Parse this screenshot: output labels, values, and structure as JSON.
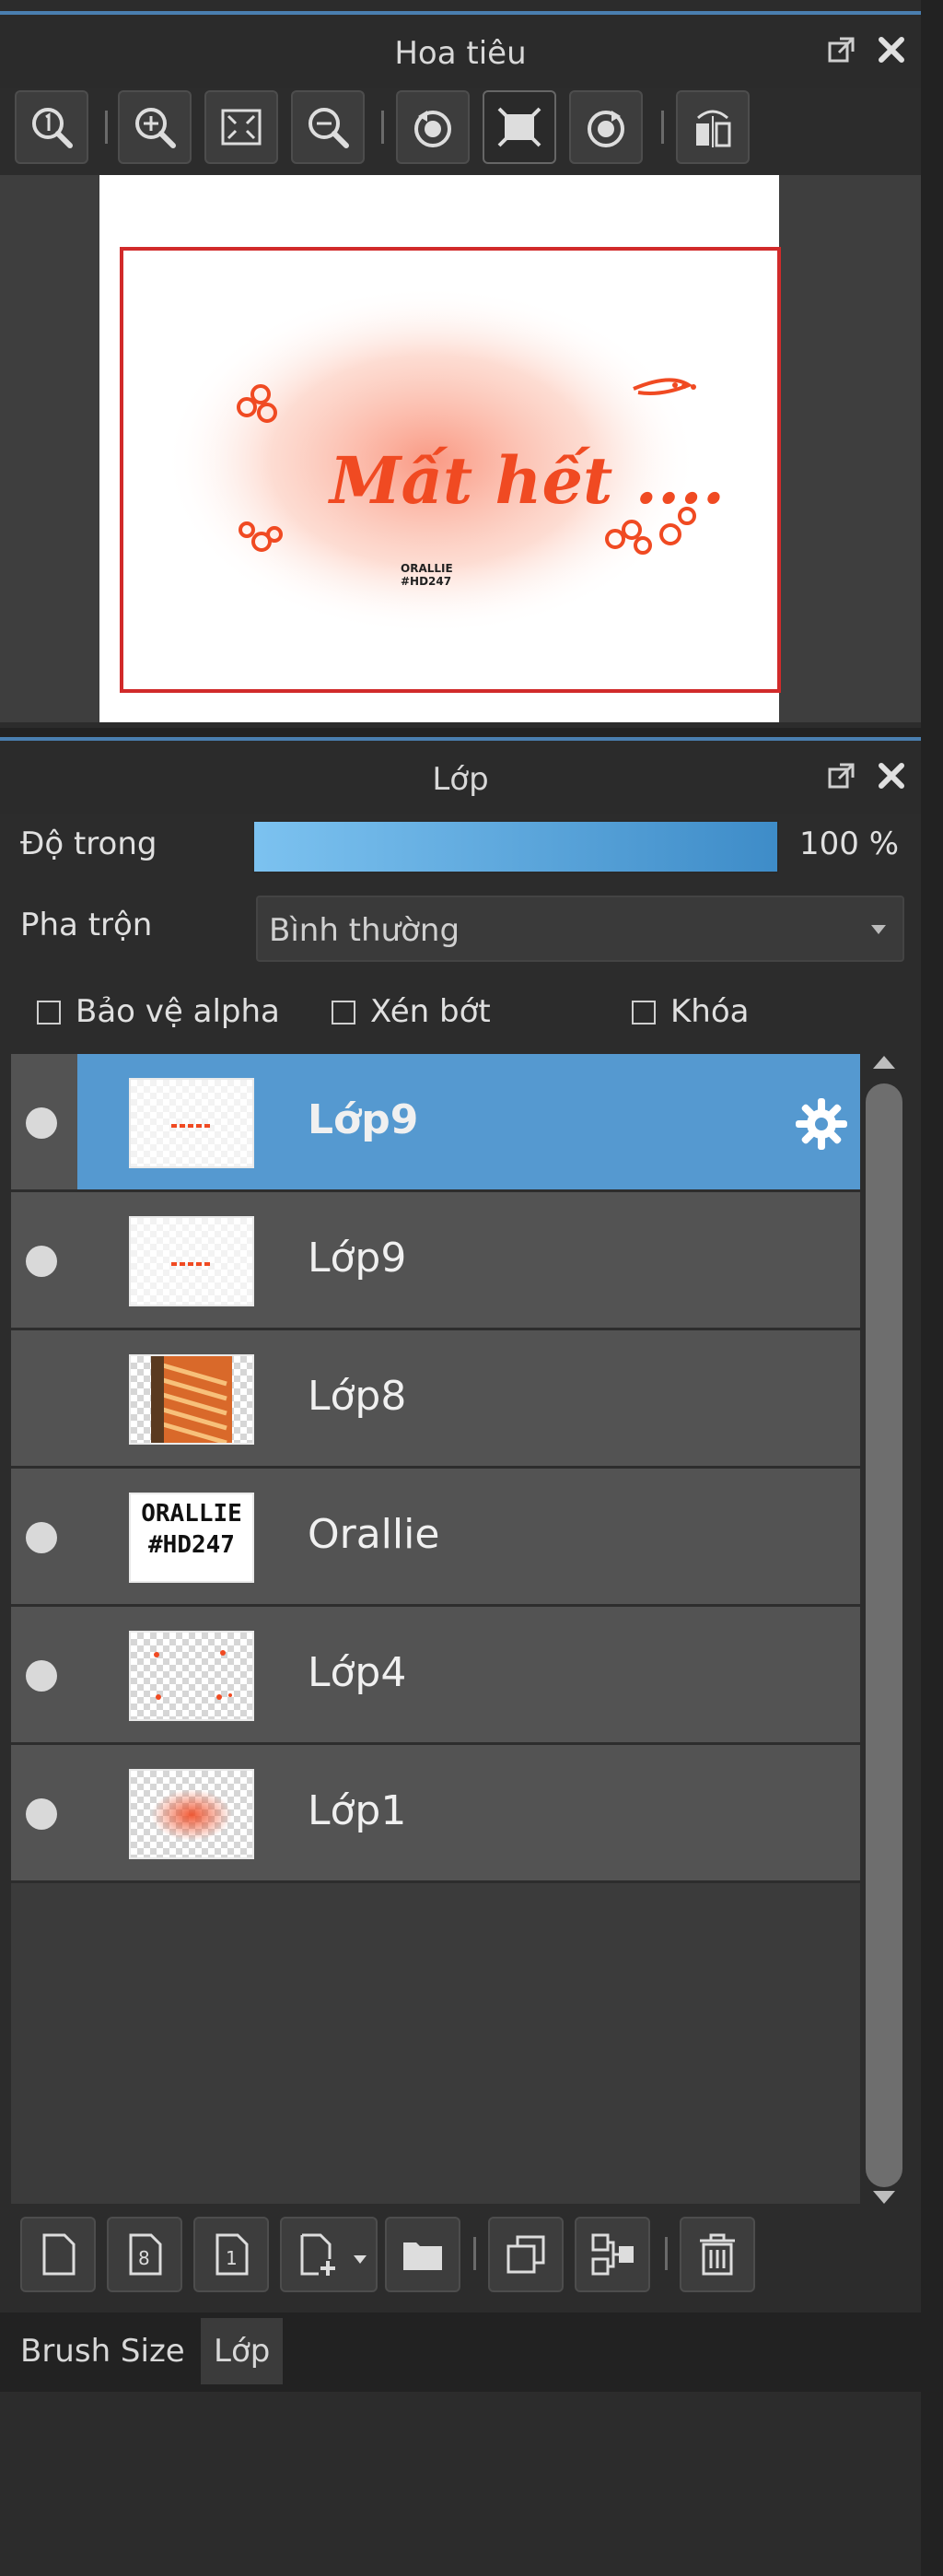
{
  "navigator": {
    "title": "Hoa tiêu",
    "canvas_text": "Mất hết ....",
    "watermark_line1": "ORALLIE",
    "watermark_line2": "#HD247"
  },
  "layers_panel": {
    "title": "Lớp",
    "opacity_label": "Độ trong",
    "opacity_value": "100 %",
    "opacity_percent": 100,
    "blend_label": "Pha trộn",
    "blend_value": "Bình thường",
    "checkboxes": {
      "protect_alpha": "Bảo vệ alpha",
      "clipping": "Xén bớt",
      "lock": "Khóa"
    },
    "layers": [
      {
        "name": "Lớp9",
        "selected": true,
        "visible": true
      },
      {
        "name": "Lớp9",
        "selected": false,
        "visible": true
      },
      {
        "name": "Lớp8",
        "selected": false,
        "visible": false
      },
      {
        "name": "Orallie",
        "selected": false,
        "visible": true
      },
      {
        "name": "Lớp4",
        "selected": false,
        "visible": true
      },
      {
        "name": "Lớp1",
        "selected": false,
        "visible": true
      }
    ]
  },
  "tabs": {
    "brush_size": "Brush Size",
    "layer": "Lớp"
  },
  "colors": {
    "accent": "#5599d0",
    "frame": "#d12a2a",
    "art": "#f04a22"
  }
}
